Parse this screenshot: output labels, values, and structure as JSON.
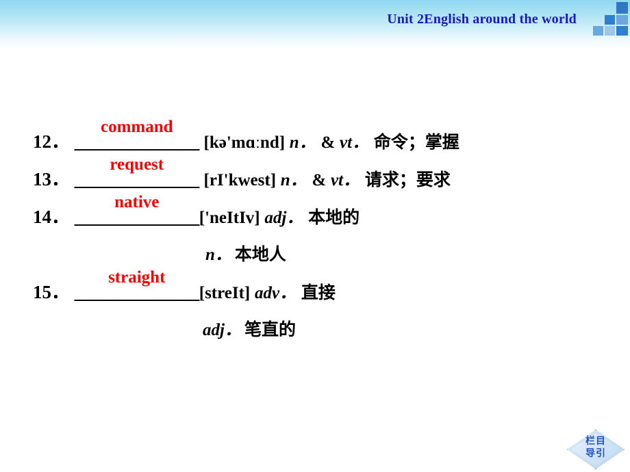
{
  "header": {
    "title": "Unit 2English around the world",
    "title_color": "#1919c8",
    "gradient_from": "#8fd7f0",
    "gradient_to": "#ffffff",
    "squares": [
      {
        "name": "square-top-right",
        "color": "#2f78c4"
      },
      {
        "name": "square-mid-right",
        "color": "#6aa8dd"
      },
      {
        "name": "square-mid-center",
        "color": "#2f7fd0"
      },
      {
        "name": "square-bottom-right",
        "color": "#2f7fd0"
      },
      {
        "name": "square-bottom-center",
        "color": "#9cc7ea"
      },
      {
        "name": "square-bottom-left",
        "color": "#6aa8dd"
      }
    ]
  },
  "vocabulary": {
    "answer_color": "#ff0000",
    "blank_placeholder": "______________",
    "entries": [
      {
        "number": "12．",
        "answer": "command",
        "blank": "______________",
        "phonetic": "[kə'mɑːnd]",
        "pos": "n．",
        "conjunction": "&",
        "pos2": "vt．",
        "meaning": "命令；掌握"
      },
      {
        "number": "13．",
        "answer": "request",
        "blank": "______________",
        "phonetic": "[rI'kwest]",
        "pos": "n．",
        "conjunction": "&",
        "pos2": "vt．",
        "meaning": "请求；要求"
      },
      {
        "number": "14．",
        "answer": "native",
        "blank": "______________",
        "phonetic": "['neItIv]",
        "pos": "adj．",
        "meaning": "本地的",
        "extra_pos": "n．",
        "extra_meaning": "本地人"
      },
      {
        "number": "15．",
        "answer": "straight",
        "blank": "______________",
        "phonetic": "[streIt]",
        "pos": "adv．",
        "meaning": "直接",
        "extra_pos": "adj．",
        "extra_meaning": "笔直的"
      }
    ]
  },
  "nav_badge": {
    "line1": "栏目",
    "line2": "导引",
    "text_color": "#1f50c8"
  }
}
